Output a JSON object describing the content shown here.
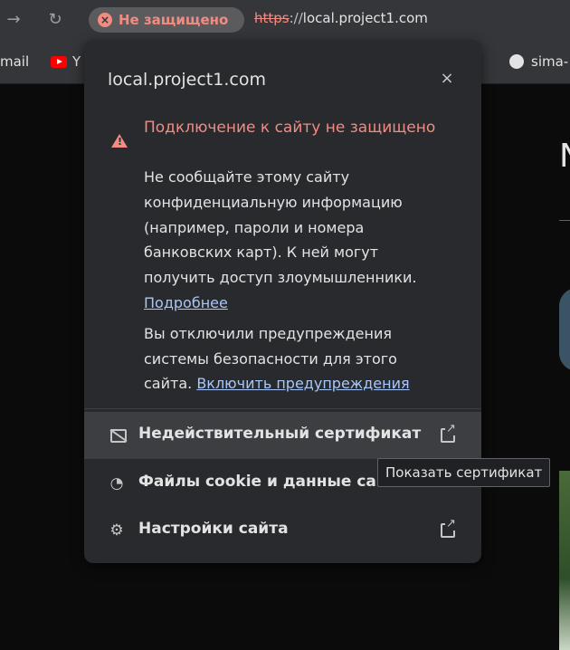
{
  "toolbar": {
    "back_icon": "arrow-right-icon",
    "reload_icon": "reload-icon",
    "security_chip": "Не защищено",
    "url_scheme": "https",
    "url_sep": "://",
    "url_host": "local.project1.com"
  },
  "bookmarks": {
    "gmail_label": "mail",
    "youtube_label": "Y",
    "github_label": "sima-"
  },
  "page": {
    "heading_letter": "N"
  },
  "popup": {
    "title": "local.project1.com",
    "close_icon": "×",
    "warning_title": "Подключение к сайту не защищено",
    "warning_lines": [
      "Не сообщайте этому сайту",
      "конфиденциальную информацию",
      "(например, пароли и номера",
      "банковских карт). К ней могут",
      "получить доступ злоумышленники."
    ],
    "learn_more": "Подробнее",
    "disabled_lines": [
      "Вы отключили предупреждения",
      "системы безопасности для этого"
    ],
    "disabled_last": "сайта.",
    "enable_warnings": "Включить предупреждения",
    "rows": [
      {
        "label": "Недействительный сертификат",
        "icon": "certificate-off-icon"
      },
      {
        "label": "Файлы cookie и данные сайтов",
        "icon": "cookie-icon"
      },
      {
        "label": "Настройки сайта",
        "icon": "gear-icon"
      }
    ]
  },
  "tooltip": {
    "text": "Показать сертификат"
  },
  "colors": {
    "danger": "#f28b82",
    "link": "#a8c7fa",
    "popup_bg": "#282a2d"
  }
}
